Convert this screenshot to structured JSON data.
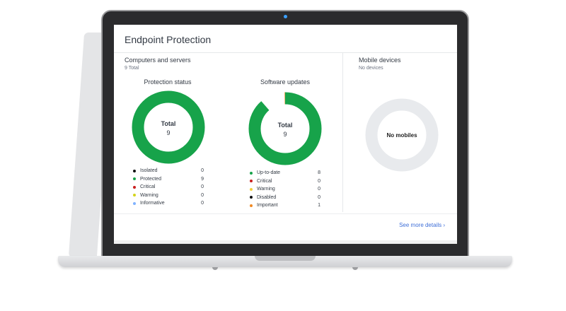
{
  "card": {
    "title": "Endpoint Protection"
  },
  "computers": {
    "title": "Computers and servers",
    "subtitle": "9 Total"
  },
  "protection": {
    "title": "Protection status",
    "center_label": "Total",
    "center_value": "9",
    "items": [
      {
        "label": "Isolated",
        "value": "0",
        "color": "#111111"
      },
      {
        "label": "Protected",
        "value": "9",
        "color": "#17a34a"
      },
      {
        "label": "Critical",
        "value": "0",
        "color": "#c81e1e"
      },
      {
        "label": "Warning",
        "value": "0",
        "color": "#d4d41a"
      },
      {
        "label": "Informative",
        "value": "0",
        "color": "#7fb2ff"
      }
    ]
  },
  "updates": {
    "title": "Software updates",
    "center_label": "Total",
    "center_value": "9",
    "items": [
      {
        "label": "Up-to-date",
        "value": "8",
        "color": "#17a34a"
      },
      {
        "label": "Critical",
        "value": "0",
        "color": "#c81e1e"
      },
      {
        "label": "Warning",
        "value": "0",
        "color": "#f2cf3b"
      },
      {
        "label": "Disabled",
        "value": "0",
        "color": "#111111"
      },
      {
        "label": "Important",
        "value": "1",
        "color": "#f08a24"
      }
    ]
  },
  "mobile": {
    "title": "Mobile devices",
    "subtitle": "No devices",
    "center_label": "No mobiles",
    "ring_color": "#e8eaed"
  },
  "footer": {
    "see_more": "See more details ›"
  },
  "colors": {
    "ring_green": "#17a34a",
    "ring_orange": "#f08a24",
    "camera": "#3aa0ff"
  }
}
